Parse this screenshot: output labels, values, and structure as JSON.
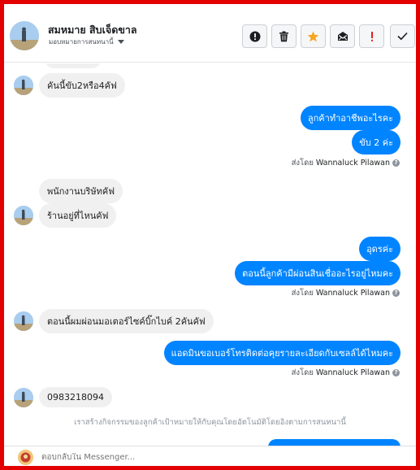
{
  "header": {
    "contact_name": "สมหมาย สิบเจ็ดขาล",
    "assignee_label": "มอบหมายการสนทนานี้"
  },
  "toolbar": {
    "buttons": [
      {
        "name": "info-button",
        "icon": "exclamation-circle-icon"
      },
      {
        "name": "trash-button",
        "icon": "trash-icon"
      },
      {
        "name": "star-button",
        "icon": "star-icon",
        "color": "#f5a623"
      },
      {
        "name": "mark-unread-button",
        "icon": "envelope-icon"
      },
      {
        "name": "spam-button",
        "icon": "exclamation-icon",
        "color": "#e02020"
      },
      {
        "name": "done-button",
        "icon": "check-icon"
      }
    ]
  },
  "messages": [
    {
      "direction": "in",
      "text": "คันนี้ขับ2หรือ4คัฟ"
    },
    {
      "direction": "out",
      "text": "ลูกค้าทำอาชีพอะไรคะ"
    },
    {
      "direction": "out",
      "text": "ขับ 2 ค่ะ"
    },
    {
      "type": "sent_by",
      "prefix": "ส่งโดย",
      "name": "Wannaluck Pilawan"
    },
    {
      "direction": "in",
      "text": "พนักงานบริษัทคัฟ"
    },
    {
      "direction": "in",
      "text": "ร้านอยู่ที่ไหนคัฟ"
    },
    {
      "direction": "out",
      "text": "อุดรค่ะ"
    },
    {
      "direction": "out",
      "text": "ตอนนี้ลูกค้ามีผ่อนสินเชื่ออะไรอยู่ไหมคะ"
    },
    {
      "type": "sent_by",
      "prefix": "ส่งโดย",
      "name": "Wannaluck Pilawan"
    },
    {
      "direction": "in",
      "text": "ตอนนี้ผมผ่อนมอเตอร์ไซค์บิ๊กไบค์ 2คันคัฟ"
    },
    {
      "direction": "out",
      "text": "แอดมินขอเบอร์โทรติดต่อคุยรายละเอียดกับเซลล์ได้ไหมคะ"
    },
    {
      "type": "sent_by",
      "prefix": "ส่งโดย",
      "name": "Wannaluck Pilawan"
    },
    {
      "direction": "in",
      "text": "0983218094"
    }
  ],
  "system_note": "เราสร้างกิจกรรมของลูกค้าเป้าหมายให้กับคุณโดยอัตโนมัติโดยอิงตามการสนทนานี้",
  "composer": {
    "placeholder": "ตอบกลับใน Messenger..."
  },
  "colors": {
    "outgoing_bubble": "#0084ff",
    "incoming_bubble": "#f1f0f0",
    "frame_border": "#e30000"
  }
}
